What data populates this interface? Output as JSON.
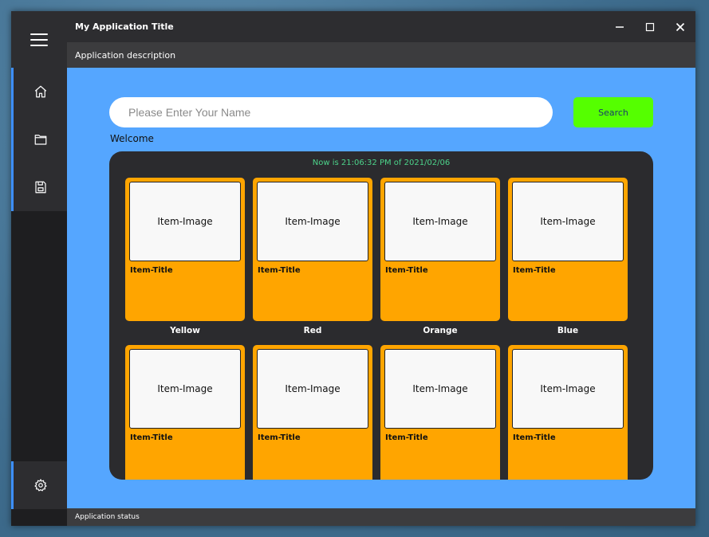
{
  "window": {
    "title": "My Application Title",
    "description": "Application description",
    "status": "Application status"
  },
  "sidebar": {
    "items": [
      {
        "icon": "home-icon",
        "name": "home"
      },
      {
        "icon": "folder-icon",
        "name": "folder"
      },
      {
        "icon": "save-icon",
        "name": "save"
      }
    ],
    "settings_icon": "gear-icon"
  },
  "search": {
    "placeholder": "Please Enter Your Name",
    "value": "",
    "button_label": "Search"
  },
  "welcome_text": "Welcome",
  "clock_text": "Now is 21:06:32 PM of 2021/02/06",
  "items": [
    {
      "image_text": "Item-Image",
      "title": "Item-Title",
      "label": "Yellow"
    },
    {
      "image_text": "Item-Image",
      "title": "Item-Title",
      "label": "Red"
    },
    {
      "image_text": "Item-Image",
      "title": "Item-Title",
      "label": "Orange"
    },
    {
      "image_text": "Item-Image",
      "title": "Item-Title",
      "label": "Blue"
    },
    {
      "image_text": "Item-Image",
      "title": "Item-Title",
      "label": ""
    },
    {
      "image_text": "Item-Image",
      "title": "Item-Title",
      "label": ""
    },
    {
      "image_text": "Item-Image",
      "title": "Item-Title",
      "label": ""
    },
    {
      "image_text": "Item-Image",
      "title": "Item-Title",
      "label": ""
    }
  ],
  "colors": {
    "accent": "#3d8fff",
    "main_bg": "#55a6ff",
    "card": "#ffa500",
    "search_button": "#55ff00",
    "clock": "#4cd38a"
  }
}
